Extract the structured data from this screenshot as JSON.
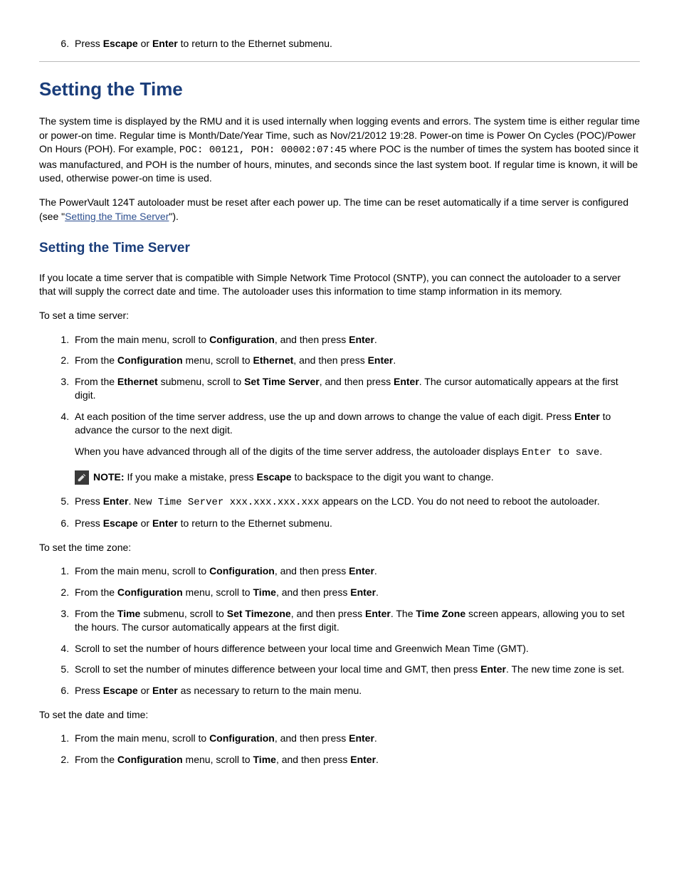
{
  "top_step6": {
    "t1": "Press ",
    "b1": "Escape",
    "t2": " or ",
    "b2": "Enter",
    "t3": " to return to the Ethernet submenu."
  },
  "h1": "Setting the Time",
  "p1": {
    "t1": "The system time is displayed by the RMU and it is used internally when logging events and errors. The system time is either regular time or power-on time. Regular time is Month/Date/Year Time, such as Nov/21/2012 19:28. Power-on time is Power On Cycles (POC)/Power On Hours (POH). For example, ",
    "c1": "POC: 00121, POH: 00002:07:45",
    "t2": " where POC is the number of times the system has booted since it was manufactured, and POH is the number of hours, minutes, and seconds since the last system boot. If regular time is known, it will be used, otherwise power-on time is used."
  },
  "p2": {
    "t1": "The PowerVault 124T autoloader must be reset after each power up. The time can be reset automatically if a time server is configured (see \"",
    "link": "Setting the Time Server",
    "t2": "\")."
  },
  "h2": "Setting the Time Server",
  "p3": "If you locate a time server that is compatible with Simple Network Time Protocol (SNTP), you can connect the autoloader to a server that will supply the correct date and time. The autoloader uses this information to time stamp information in its memory.",
  "p4": "To set a time server:",
  "server_steps": {
    "s1": {
      "t1": "From the main menu, scroll to ",
      "b1": "Configuration",
      "t2": ", and then press ",
      "b2": "Enter",
      "t3": "."
    },
    "s2": {
      "t1": "From the ",
      "b1": "Configuration",
      "t2": " menu, scroll to ",
      "b2": "Ethernet",
      "t3": ", and then press ",
      "b3": "Enter",
      "t4": "."
    },
    "s3": {
      "t1": "From the ",
      "b1": "Ethernet",
      "t2": " submenu, scroll to ",
      "b2": "Set Time Server",
      "t3": ", and then press ",
      "b3": "Enter",
      "t4": ". The cursor automatically appears at the first digit."
    },
    "s4": {
      "t1": "At each position of the time server address, use the up and down arrows to change the value of each digit. Press ",
      "b1": "Enter",
      "t2": " to advance the cursor to the next digit.",
      "sub1_t1": "When you have advanced through all of the digits of the time server address, the autoloader displays ",
      "sub1_c1": "Enter to save",
      "sub1_t2": ".",
      "note_b": "NOTE:",
      "note_t1": " If you make a mistake, press ",
      "note_b2": "Escape",
      "note_t2": " to backspace to the digit you want to change."
    },
    "s5": {
      "t1": "Press ",
      "b1": "Enter",
      "t2": ". ",
      "c1": "New Time Server xxx.xxx.xxx.xxx",
      "t3": " appears on the LCD. You do not need to reboot the autoloader."
    },
    "s6": {
      "t1": "Press ",
      "b1": "Escape",
      "t2": " or ",
      "b2": "Enter",
      "t3": " to return to the Ethernet submenu."
    }
  },
  "p5": "To set the time zone:",
  "tz_steps": {
    "s1": {
      "t1": "From the main menu, scroll to ",
      "b1": "Configuration",
      "t2": ", and then press ",
      "b2": "Enter",
      "t3": "."
    },
    "s2": {
      "t1": "From the ",
      "b1": "Configuration",
      "t2": " menu, scroll to ",
      "b2": "Time",
      "t3": ", and then press ",
      "b3": "Enter",
      "t4": "."
    },
    "s3": {
      "t1": "From the ",
      "b1": "Time",
      "t2": " submenu, scroll to ",
      "b2": "Set Timezone",
      "t3": ", and then press ",
      "b3": "Enter",
      "t4": ". The ",
      "b4": "Time Zone",
      "t5": " screen appears, allowing you to set the hours. The cursor automatically appears at the first digit."
    },
    "s4": {
      "t1": "Scroll to set the number of hours difference between your local time and Greenwich Mean Time (GMT)."
    },
    "s5": {
      "t1": "Scroll to set the number of minutes difference between your local time and GMT, then press ",
      "b1": "Enter",
      "t2": ". The new time zone is set."
    },
    "s6": {
      "t1": "Press ",
      "b1": "Escape",
      "t2": " or ",
      "b2": "Enter",
      "t3": " as necessary to return to the main menu."
    }
  },
  "p6": "To set the date and time:",
  "dt_steps": {
    "s1": {
      "t1": "From the main menu, scroll to ",
      "b1": "Configuration",
      "t2": ", and then press ",
      "b2": "Enter",
      "t3": "."
    },
    "s2": {
      "t1": "From the ",
      "b1": "Configuration",
      "t2": " menu, scroll to ",
      "b2": "Time",
      "t3": ", and then press ",
      "b3": "Enter",
      "t4": "."
    }
  }
}
